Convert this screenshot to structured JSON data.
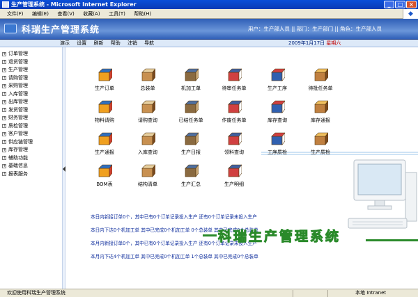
{
  "window": {
    "title": "生产管理系统 - Microsoft Internet Explorer",
    "buttons": [
      "_",
      "□",
      "×"
    ]
  },
  "menu": {
    "items": [
      "文件(F)",
      "编辑(E)",
      "查看(V)",
      "收藏(A)",
      "工具(T)",
      "帮助(H)"
    ]
  },
  "header": {
    "app_name": "科瑞生产管理系统",
    "user_info": "用户：生产部人员 || 部门：生产部门 || 角色：生产部人员"
  },
  "toolbar": {
    "links": [
      "演示",
      "设置",
      "刷新",
      "帮助",
      "注销",
      "导航"
    ],
    "date": "2009年1月17日",
    "weekday": "星期六"
  },
  "sidebar": {
    "items": [
      "订单管理",
      "退货管理",
      "生产管理",
      "请购管理",
      "采购管理",
      "入库管理",
      "出库管理",
      "发货管理",
      "财务管理",
      "质检管理",
      "客户管理",
      "供应链管理",
      "库存管理",
      "辅助功能",
      "基础信息",
      "报表服务"
    ]
  },
  "tiles": [
    {
      "label": "生产订单",
      "icon": "order-boxes-icon"
    },
    {
      "label": "总装单",
      "icon": "assembly-box-icon"
    },
    {
      "label": "机加工单",
      "icon": "machining-box-icon"
    },
    {
      "label": "待审任务单",
      "icon": "pending-task-icon"
    },
    {
      "label": "生产工序",
      "icon": "process-list-icon"
    },
    {
      "label": "待批任务单",
      "icon": "approval-boxes-icon"
    },
    {
      "label": "物料请购",
      "icon": "material-request-icon"
    },
    {
      "label": "请购查询",
      "icon": "request-search-icon"
    },
    {
      "label": "已结任务单",
      "icon": "closed-task-icon"
    },
    {
      "label": "作废任务单",
      "icon": "void-task-icon"
    },
    {
      "label": "库存查询",
      "icon": "stock-search-icon"
    },
    {
      "label": "库存通报",
      "icon": "stock-report-icon"
    },
    {
      "label": "生产通报",
      "icon": "production-report-icon"
    },
    {
      "label": "入库查询",
      "icon": "inbound-search-icon"
    },
    {
      "label": "生产日报",
      "icon": "daily-report-icon"
    },
    {
      "label": "领料查询",
      "icon": "picking-search-icon"
    },
    {
      "label": "工序质检",
      "icon": "process-qc-icon"
    },
    {
      "label": "生产质检",
      "icon": "production-qc-icon"
    },
    {
      "label": "BOM表",
      "icon": "bom-disk-icon"
    },
    {
      "label": "结构清单",
      "icon": "structure-list-icon"
    },
    {
      "label": "生产汇总",
      "icon": "summary-icon"
    },
    {
      "label": "生产明细",
      "icon": "detail-icon"
    }
  ],
  "stats": [
    "本日内新接订单0个，其中已有0个订单记录投入生产  还有0个订单记录未投入生产",
    "本日内下达0个机加工单 其中已完成0个机加工单  0个总装单  其中已完成0个总装单",
    "本月内新接订单0个，其中已有0个订单记录投入生产  还有0个订单记录未投入生产",
    "本月内下达4个机加工单 其中已完成0个机加工单  1个总装单  其中已完成0个总装单"
  ],
  "watermark": "科瑞生产管理系统",
  "status": {
    "message": "欢迎使用科瑞生产管理系统",
    "zone": "本地 Intranet"
  },
  "colors": {
    "header": "#2f5fb7",
    "stats_text": "#0a2a9b",
    "watermark_outline": "#2a8a2a",
    "weekday": "#c20000"
  }
}
